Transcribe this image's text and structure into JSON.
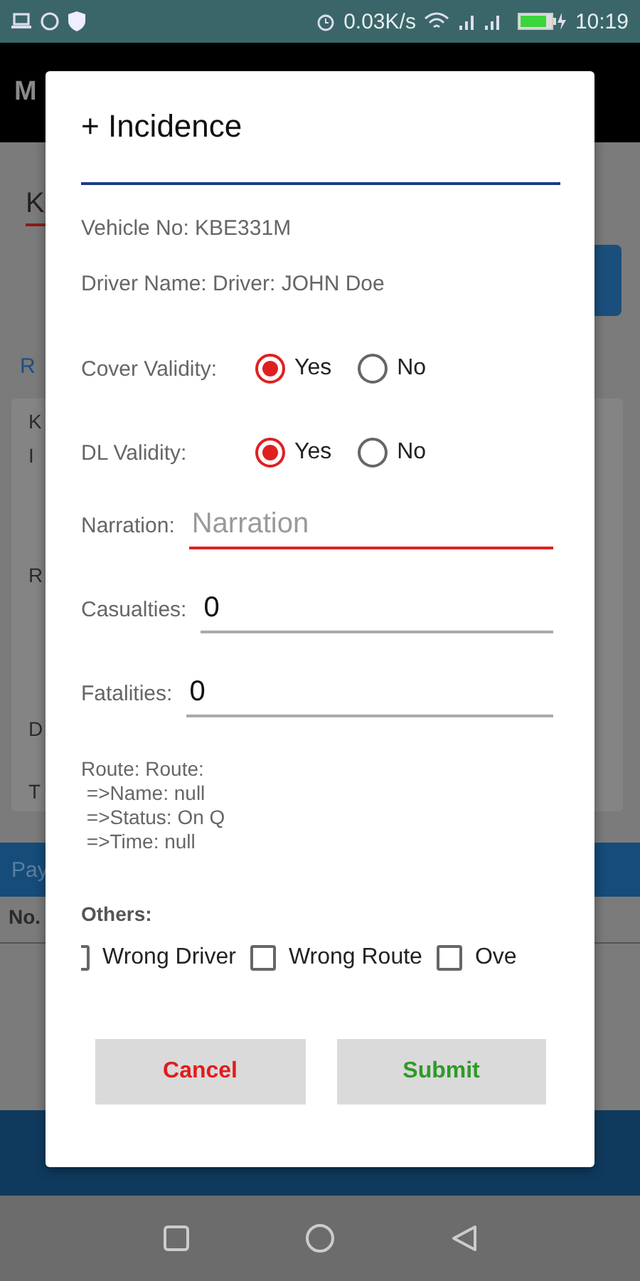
{
  "status_bar": {
    "speed": "0.03K/s",
    "time": "10:19"
  },
  "background": {
    "toolbar_title": "M",
    "tab_label": "K",
    "link": "R",
    "card_lines": [
      "K",
      "I",
      "R",
      "D",
      "T"
    ],
    "section_bar": "Pay",
    "column_header": "No."
  },
  "dialog": {
    "title": "+ Incidence",
    "info": [
      "Vehicle No: KBE331M",
      "Driver Name: Driver: JOHN Doe"
    ],
    "radio_groups": [
      {
        "label": "Cover Validity:",
        "options": [
          {
            "label": "Yes",
            "selected": true
          },
          {
            "label": "No",
            "selected": false
          }
        ]
      },
      {
        "label": "DL Validity:",
        "options": [
          {
            "label": "Yes",
            "selected": true
          },
          {
            "label": "No",
            "selected": false
          }
        ]
      }
    ],
    "fields": [
      {
        "label": "Narration:",
        "placeholder": "Narration",
        "focused": true
      },
      {
        "label": "Casualties:",
        "value": "0",
        "focused": false
      },
      {
        "label": "Fatalities:",
        "value": "0",
        "focused": false
      }
    ],
    "route": "Route: Route:\n =>Name: null\n =>Status: On Q\n =>Time: null",
    "others_label": "Others:",
    "others": [
      {
        "label": "Wrong Driver",
        "checked": false
      },
      {
        "label": "Wrong Route",
        "checked": false
      },
      {
        "label": "Ove",
        "checked": false
      }
    ],
    "buttons": [
      {
        "label": "Cancel",
        "kind": "cancel"
      },
      {
        "label": "Submit",
        "kind": "submit"
      }
    ]
  }
}
